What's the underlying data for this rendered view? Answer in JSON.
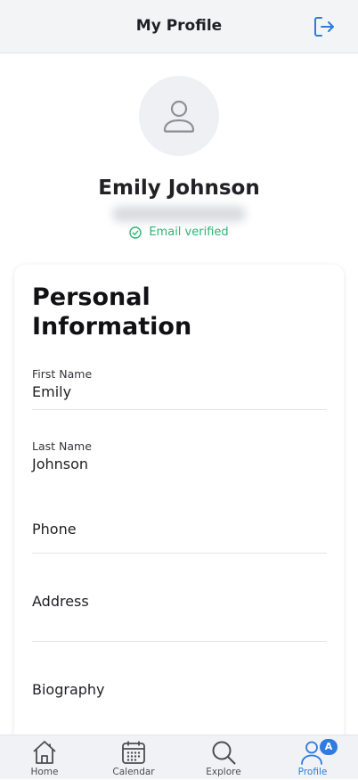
{
  "header": {
    "title": "My Profile",
    "logout_icon": "logout-icon"
  },
  "profile": {
    "avatar_icon": "user-icon",
    "name": "Emily Johnson",
    "verified_label": "Email verified",
    "verified_color": "#2bb673"
  },
  "personal_info": {
    "title": "Personal Information",
    "first_name": {
      "label": "First Name",
      "value": "Emily"
    },
    "last_name": {
      "label": "Last Name",
      "value": "Johnson"
    },
    "phone": {
      "label": "Phone"
    },
    "address": {
      "label": "Address"
    },
    "biography": {
      "label": "Biography"
    }
  },
  "tabbar": {
    "active_color": "#2f7be0",
    "tabs": [
      {
        "label": "Home",
        "icon": "home-icon"
      },
      {
        "label": "Calendar",
        "icon": "calendar-icon"
      },
      {
        "label": "Explore",
        "icon": "search-icon"
      },
      {
        "label": "Profile",
        "icon": "profile-icon",
        "active": true,
        "badge": "A"
      }
    ]
  }
}
